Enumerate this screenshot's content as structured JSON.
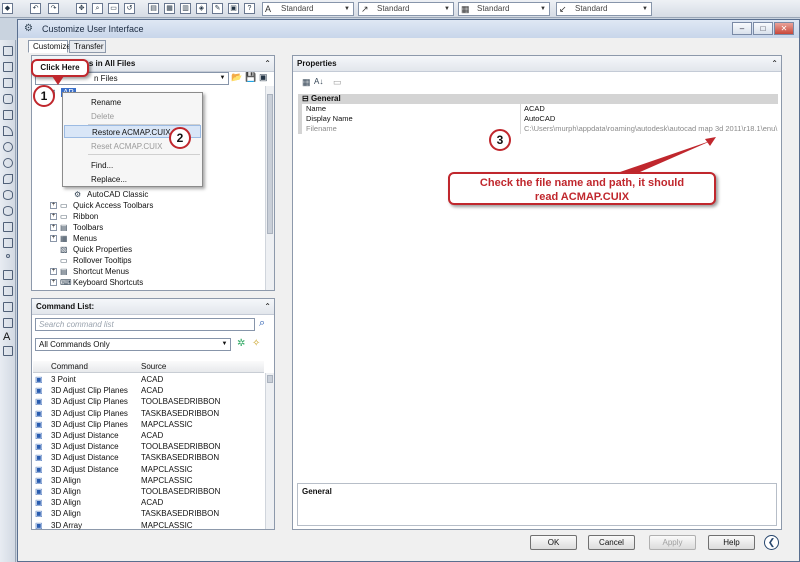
{
  "window": {
    "title": "Customize User Interface",
    "tabs": [
      "Customize",
      "Transfer"
    ]
  },
  "topbar": {
    "combos": [
      "Standard",
      "Standard",
      "Standard",
      "Standard"
    ]
  },
  "customizations_panel": {
    "header": "ns in All Files",
    "file_dropdown": "n Files",
    "tree": [
      {
        "label": "AutoCAD Classic",
        "expand": ""
      },
      {
        "label": "Quick Access Toolbars",
        "expand": "+"
      },
      {
        "label": "Ribbon",
        "expand": "+"
      },
      {
        "label": "Toolbars",
        "expand": "+"
      },
      {
        "label": "Menus",
        "expand": "+"
      },
      {
        "label": "Quick Properties",
        "expand": ""
      },
      {
        "label": "Rollover Tooltips",
        "expand": ""
      },
      {
        "label": "Shortcut Menus",
        "expand": "+"
      },
      {
        "label": "Keyboard Shortcuts",
        "expand": "+"
      }
    ],
    "root_label": "AP"
  },
  "context_menu": {
    "items": [
      {
        "label": "Rename",
        "disabled": false,
        "highlight": false
      },
      {
        "label": "Delete",
        "disabled": true,
        "highlight": false
      },
      {
        "label": "Restore ACMAP.CUIX",
        "disabled": false,
        "highlight": true
      },
      {
        "label": "Reset ACMAP.CUIX",
        "disabled": true,
        "highlight": false
      },
      {
        "label": "Find...",
        "disabled": false,
        "highlight": false
      },
      {
        "label": "Replace...",
        "disabled": false,
        "highlight": false
      }
    ]
  },
  "command_list": {
    "header": "Command List:",
    "search_placeholder": "Search command list",
    "filter": "All Commands Only",
    "columns": [
      "Command",
      "Source"
    ],
    "rows": [
      [
        "3 Point",
        "ACAD"
      ],
      [
        "3D Adjust Clip Planes",
        "ACAD"
      ],
      [
        "3D Adjust Clip Planes",
        "TOOLBASEDRIBBON"
      ],
      [
        "3D Adjust Clip Planes",
        "TASKBASEDRIBBON"
      ],
      [
        "3D Adjust Clip Planes",
        "MAPCLASSIC"
      ],
      [
        "3D Adjust Distance",
        "ACAD"
      ],
      [
        "3D Adjust Distance",
        "TOOLBASEDRIBBON"
      ],
      [
        "3D Adjust Distance",
        "TASKBASEDRIBBON"
      ],
      [
        "3D Adjust Distance",
        "MAPCLASSIC"
      ],
      [
        "3D Align",
        "MAPCLASSIC"
      ],
      [
        "3D Align",
        "TOOLBASEDRIBBON"
      ],
      [
        "3D Align",
        "ACAD"
      ],
      [
        "3D Align",
        "TASKBASEDRIBBON"
      ],
      [
        "3D Array",
        "MAPCLASSIC"
      ]
    ]
  },
  "properties": {
    "header": "Properties",
    "section": "General",
    "rows": [
      {
        "key": "Name",
        "value": "ACAD"
      },
      {
        "key": "Display Name",
        "value": "AutoCAD"
      },
      {
        "key": "Filename",
        "value": "C:\\Users\\murph\\appdata\\roaming\\autodesk\\autocad map 3d 2011\\r18.1\\enu\\"
      }
    ],
    "bottom_header": "General"
  },
  "buttons": {
    "ok": "OK",
    "cancel": "Cancel",
    "apply": "Apply",
    "help": "Help"
  },
  "annotations": {
    "click_here": "Click Here",
    "n1": "1",
    "n2": "2",
    "n3": "3",
    "note": "Check the file name and path, it should read ACMAP.CUIX",
    "accent": "#c0272d"
  }
}
